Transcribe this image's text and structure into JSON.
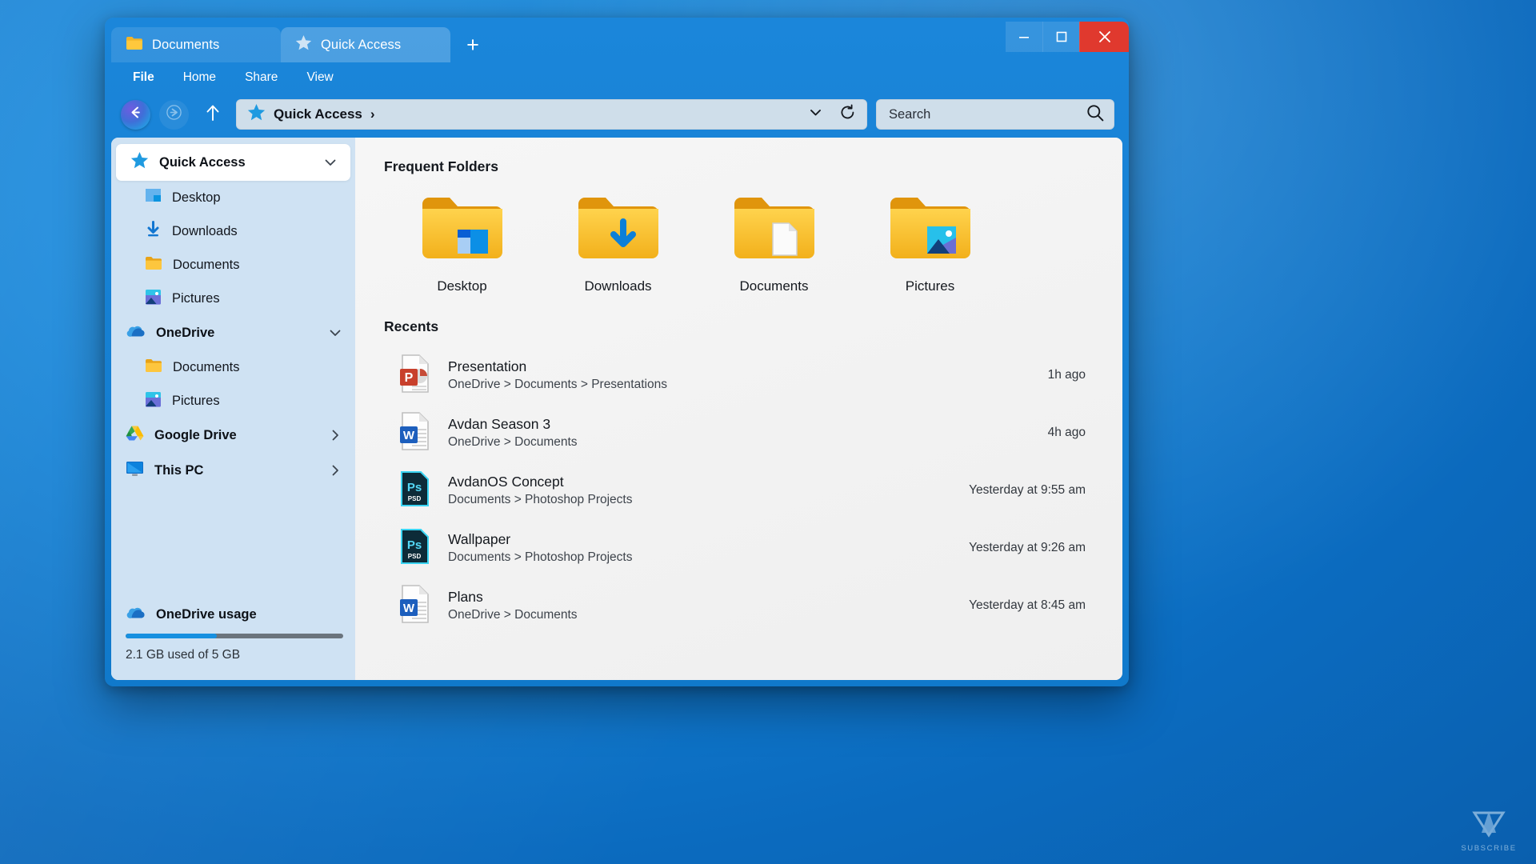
{
  "window": {
    "tabs": [
      {
        "label": "Documents",
        "icon": "folder-icon",
        "active": false
      },
      {
        "label": "Quick Access",
        "icon": "star-icon",
        "active": true
      }
    ],
    "new_tab_label": "+",
    "controls": {
      "minimize": "minimize-icon",
      "maximize": "maximize-icon",
      "close": "close-icon",
      "close_color": "#e0392e"
    }
  },
  "menubar": {
    "items": [
      "File",
      "Home",
      "Share",
      "View"
    ]
  },
  "address": {
    "back": "back-arrow-icon",
    "forward": "forward-arrow-icon",
    "up": "up-arrow-icon",
    "breadcrumb": "Quick Access",
    "breadcrumb_separator": "›",
    "dropdown": "chevron-down-icon",
    "refresh": "refresh-icon"
  },
  "search": {
    "placeholder": "Search",
    "icon": "search-icon"
  },
  "sidebar": {
    "groups": [
      {
        "label": "Quick Access",
        "icon": "star-icon",
        "selected": true,
        "chevron": "chevron-down",
        "items": [
          {
            "label": "Desktop",
            "icon": "desktop-icon"
          },
          {
            "label": "Downloads",
            "icon": "download-arrow-icon"
          },
          {
            "label": "Documents",
            "icon": "folder-icon"
          },
          {
            "label": "Pictures",
            "icon": "pictures-icon"
          }
        ]
      },
      {
        "label": "OneDrive",
        "icon": "onedrive-cloud-icon",
        "selected": false,
        "chevron": "chevron-down",
        "items": [
          {
            "label": "Documents",
            "icon": "folder-icon"
          },
          {
            "label": "Pictures",
            "icon": "pictures-icon"
          }
        ]
      },
      {
        "label": "Google Drive",
        "icon": "google-drive-icon",
        "selected": false,
        "chevron": "chevron-right",
        "items": []
      },
      {
        "label": "This PC",
        "icon": "this-pc-icon",
        "selected": false,
        "chevron": "chevron-right",
        "items": []
      }
    ],
    "usage": {
      "title": "OneDrive usage",
      "icon": "onedrive-cloud-icon",
      "percent": 42,
      "text": "2.1 GB used of 5 GB",
      "bar_color": "#1790e0",
      "track_color": "#6b747d"
    }
  },
  "main": {
    "frequent_folders": {
      "title": "Frequent Folders",
      "items": [
        {
          "label": "Desktop",
          "overlay": "desktop-overlay"
        },
        {
          "label": "Downloads",
          "overlay": "download-overlay"
        },
        {
          "label": "Documents",
          "overlay": "document-overlay"
        },
        {
          "label": "Pictures",
          "overlay": "picture-overlay"
        }
      ]
    },
    "recents": {
      "title": "Recents",
      "items": [
        {
          "name": "Presentation",
          "path": "OneDrive > Documents > Presentations",
          "time": "1h ago",
          "icon": "powerpoint-file-icon"
        },
        {
          "name": "Avdan Season 3",
          "path": "OneDrive > Documents",
          "time": "4h ago",
          "icon": "word-file-icon"
        },
        {
          "name": "AvdanOS Concept",
          "path": "Documents > Photoshop Projects",
          "time": "Yesterday at 9:55 am",
          "icon": "photoshop-file-icon"
        },
        {
          "name": "Wallpaper",
          "path": "Documents > Photoshop Projects",
          "time": "Yesterday at 9:26 am",
          "icon": "photoshop-file-icon"
        },
        {
          "name": "Plans",
          "path": "OneDrive > Documents",
          "time": "Yesterday at 8:45 am",
          "icon": "word-file-icon"
        }
      ]
    }
  },
  "watermark": {
    "text": "SUBSCRIBE",
    "icon": "triangle-logo-icon"
  }
}
